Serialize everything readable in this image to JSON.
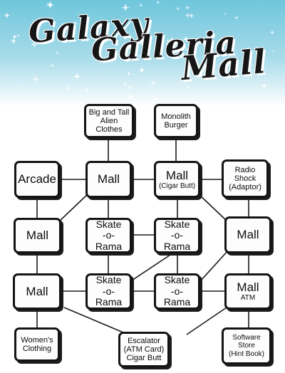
{
  "title": {
    "line1": "Galaxy",
    "line2": "Galleria",
    "line3": "Mall"
  },
  "colors": {
    "sky_top": "#6fc6dc",
    "sky_bottom": "#ffffff",
    "box_border": "#141414",
    "line": "#1a1a1a"
  },
  "rooms": {
    "bigtall": {
      "label": "Big and Tall\nAlien\nClothes"
    },
    "monolith": {
      "label": "Monolith\nBurger"
    },
    "arcade": {
      "label": "Arcade"
    },
    "mall_r2a": {
      "label": "Mall"
    },
    "mall_r2b": {
      "label": "Mall",
      "sub": "(Cigar Butt)"
    },
    "radio": {
      "label": "Radio\nShock\n(Adaptor)"
    },
    "mall_r3a": {
      "label": "Mall"
    },
    "skate_r3a": {
      "label": "Skate\n-o-\nRama"
    },
    "skate_r3b": {
      "label": "Skate\n-o-\nRama"
    },
    "mall_r3b": {
      "label": "Mall"
    },
    "mall_r4a": {
      "label": "Mall"
    },
    "skate_r4a": {
      "label": "Skate\n-o-\nRama"
    },
    "skate_r4b": {
      "label": "Skate\n-o-\nRama"
    },
    "mall_atm": {
      "label": "Mall",
      "sub": "ATM"
    },
    "womens": {
      "label": "Women's\nClothing"
    },
    "escalator": {
      "label": "Escalator\n(ATM Card)\nCigar Butt"
    },
    "software": {
      "label": "Software\nStore\n(Hint Book)"
    }
  }
}
